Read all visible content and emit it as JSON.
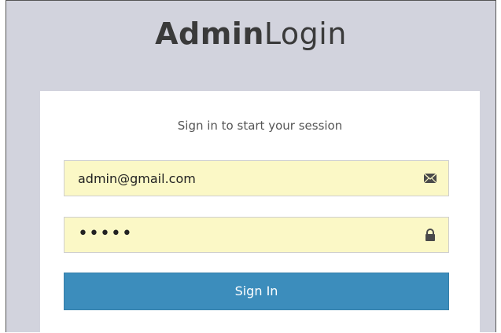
{
  "logo": {
    "bold": "Admin",
    "light": "Login"
  },
  "login": {
    "message": "Sign in to start your session",
    "email_value": "admin@gmail.com",
    "password_value": "•••••",
    "email_icon": "envelope-icon",
    "password_icon": "lock-icon",
    "submit_label": "Sign In"
  },
  "colors": {
    "background": "#d2d3dd",
    "input_fill": "#fbf8c6",
    "button": "#3c8dbc"
  }
}
